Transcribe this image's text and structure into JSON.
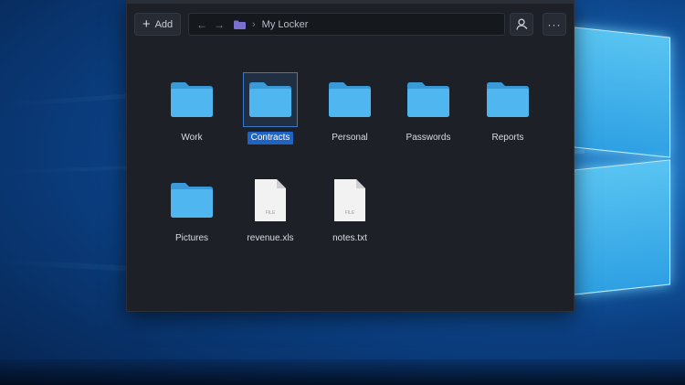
{
  "toolbar": {
    "add_label": "Add",
    "add_icon": "plus-icon",
    "path_current": "My Locker",
    "back_icon": "arrow-left-icon",
    "forward_icon": "arrow-right-icon",
    "user_icon": "user-icon",
    "more_icon": "more-icon",
    "more_glyph": "···"
  },
  "items": [
    {
      "label": "Work",
      "type": "folder"
    },
    {
      "label": "Contracts",
      "type": "folder",
      "selected": true
    },
    {
      "label": "Personal",
      "type": "folder"
    },
    {
      "label": "Passwords",
      "type": "folder"
    },
    {
      "label": "Reports",
      "type": "folder"
    },
    {
      "label": "Pictures",
      "type": "folder"
    },
    {
      "label": "revenue.xls",
      "type": "file",
      "file_tag": "FILE"
    },
    {
      "label": "notes.txt",
      "type": "file",
      "file_tag": "FILE"
    }
  ],
  "colors": {
    "folder": "#4fb6ef",
    "folder_tab": "#3a9ad8",
    "selection": "#1f63c4",
    "window_bg": "#1d2127",
    "breadcrumb_folder": "#7b6fd0"
  }
}
